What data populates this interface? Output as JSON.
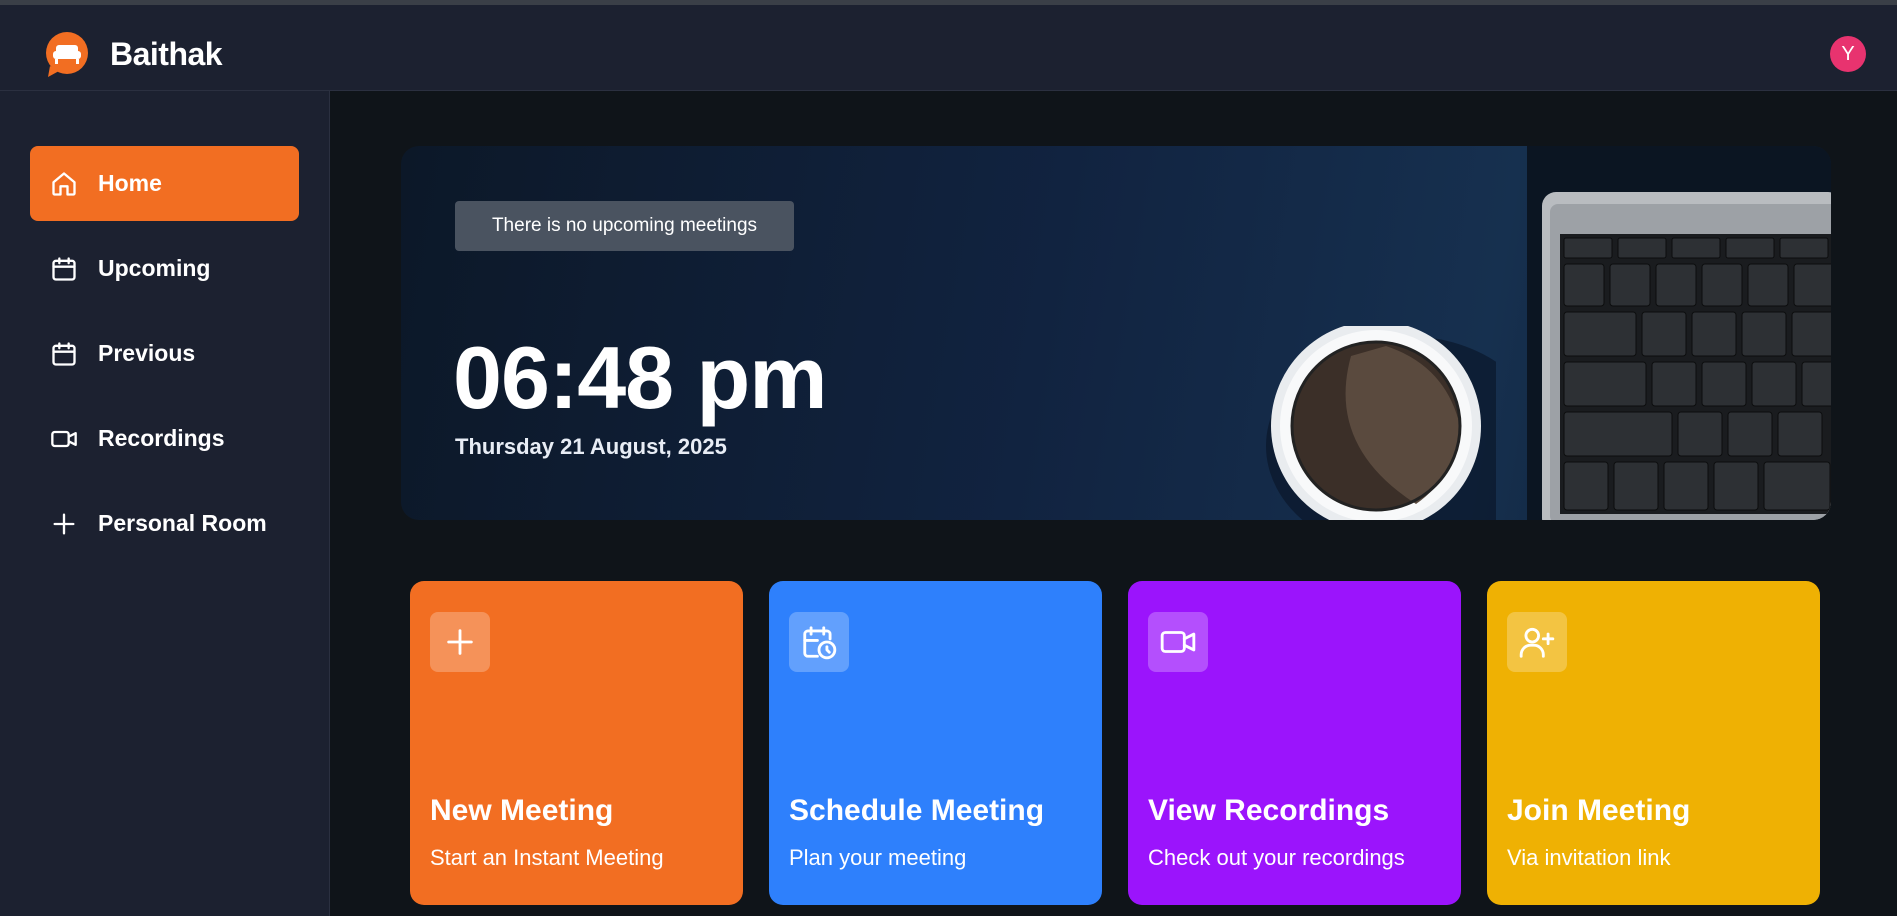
{
  "app": {
    "name": "Baithak",
    "avatar_initial": "Y",
    "accent": "#f26e22"
  },
  "sidebar": {
    "items": [
      {
        "label": "Home",
        "icon": "home-icon",
        "active": true
      },
      {
        "label": "Upcoming",
        "icon": "calendar-icon",
        "active": false
      },
      {
        "label": "Previous",
        "icon": "calendar-icon",
        "active": false
      },
      {
        "label": "Recordings",
        "icon": "video-icon",
        "active": false
      },
      {
        "label": "Personal Room",
        "icon": "plus-icon",
        "active": false
      }
    ]
  },
  "hero": {
    "badge": "There is no upcoming meetings",
    "time": "06:48 pm",
    "date": "Thursday 21 August, 2025"
  },
  "cards": [
    {
      "title": "New Meeting",
      "subtitle": "Start an Instant Meeting",
      "icon": "plus-icon",
      "color": "#f26e22"
    },
    {
      "title": "Schedule Meeting",
      "subtitle": "Plan your meeting",
      "icon": "calendar-clock-icon",
      "color": "#2e80fc"
    },
    {
      "title": "View Recordings",
      "subtitle": "Check out your recordings",
      "icon": "video-icon",
      "color": "#9b14fc"
    },
    {
      "title": "Join Meeting",
      "subtitle": "Via invitation link",
      "icon": "user-plus-icon",
      "color": "#efb103"
    }
  ]
}
